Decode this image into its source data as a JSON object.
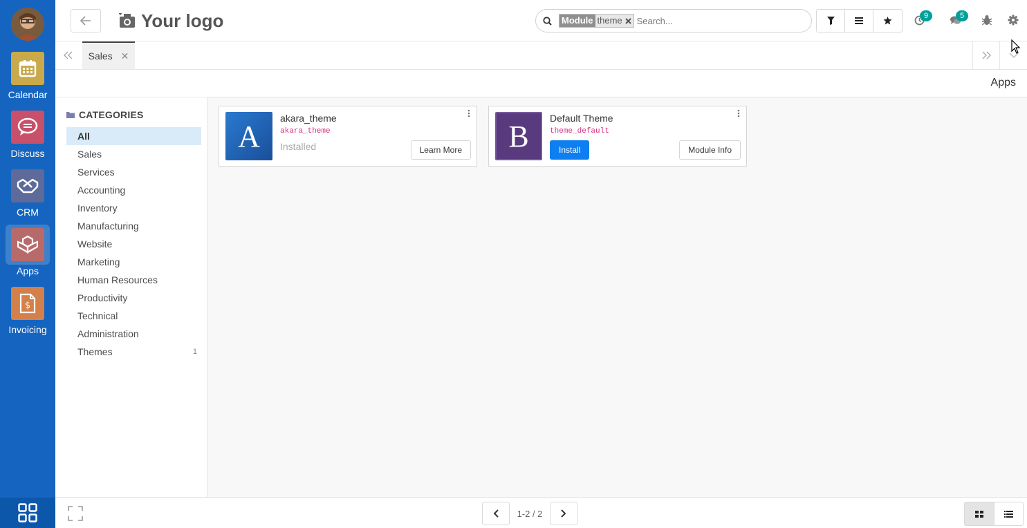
{
  "sidebar": {
    "apps": [
      {
        "label": "Calendar",
        "icon": "calendar-icon",
        "color": "#c9a94a"
      },
      {
        "label": "Discuss",
        "icon": "chat-bubble-icon",
        "color": "#c8506a"
      },
      {
        "label": "CRM",
        "icon": "handshake-icon",
        "color": "#5d6a9a"
      },
      {
        "label": "Apps",
        "icon": "cubes-icon",
        "color": "#b86a6a",
        "active": true
      },
      {
        "label": "Invoicing",
        "icon": "invoice-dollar-icon",
        "color": "#d4804a"
      }
    ]
  },
  "topbar": {
    "logo_text": "Your logo",
    "search": {
      "facet_key": "Module",
      "facet_value": "theme",
      "placeholder": "Search..."
    },
    "activity_count": "9",
    "messages_count": "5"
  },
  "tabs": [
    {
      "label": "Sales",
      "active": true
    }
  ],
  "breadcrumb": "Apps",
  "categories": {
    "header": "CATEGORIES",
    "items": [
      {
        "label": "All",
        "active": true,
        "count": ""
      },
      {
        "label": "Sales",
        "count": ""
      },
      {
        "label": "Services",
        "count": ""
      },
      {
        "label": "Accounting",
        "count": ""
      },
      {
        "label": "Inventory",
        "count": ""
      },
      {
        "label": "Manufacturing",
        "count": ""
      },
      {
        "label": "Website",
        "count": ""
      },
      {
        "label": "Marketing",
        "count": ""
      },
      {
        "label": "Human Resources",
        "count": ""
      },
      {
        "label": "Productivity",
        "count": ""
      },
      {
        "label": "Technical",
        "count": ""
      },
      {
        "label": "Administration",
        "count": ""
      },
      {
        "label": "Themes",
        "count": "1"
      }
    ]
  },
  "modules": [
    {
      "letter": "A",
      "title": "akara_theme",
      "technical_name": "akara_theme",
      "status": "Installed",
      "button": "Learn More",
      "color": "#1e63b8"
    },
    {
      "letter": "B",
      "title": "Default Theme",
      "technical_name": "theme_default",
      "primary_button": "Install",
      "button": "Module Info",
      "color": "#5a3a7e"
    }
  ],
  "pager": {
    "value": "1-2 / 2"
  },
  "colors": {
    "sidebar": "#1565c0",
    "primary": "#0d7ff0",
    "badge": "#00a09d",
    "active_category": "#d9ebf9"
  }
}
